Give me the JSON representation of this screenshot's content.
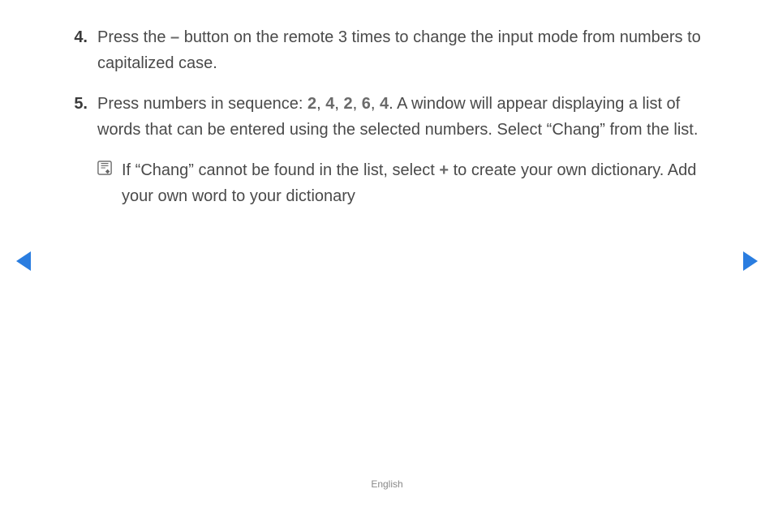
{
  "items": [
    {
      "number": "4.",
      "text_before": "Press the ",
      "bold1": "–",
      "text_after_1": " button on the remote 3 times to change the input mode from numbers to capitalized case."
    },
    {
      "number": "5.",
      "text_before": "Press numbers in sequence: ",
      "seq": [
        "2",
        "4",
        "2",
        "6",
        "4"
      ],
      "text_after": ". A window will appear displaying a list of words that can be entered using the selected numbers. Select “Chang” from the list."
    }
  ],
  "note": {
    "text_before": "If “Chang” cannot be found in the list, select ",
    "bold": "+",
    "text_after": " to create your own dictionary. Add your own word to your dictionary"
  },
  "footer": "English"
}
